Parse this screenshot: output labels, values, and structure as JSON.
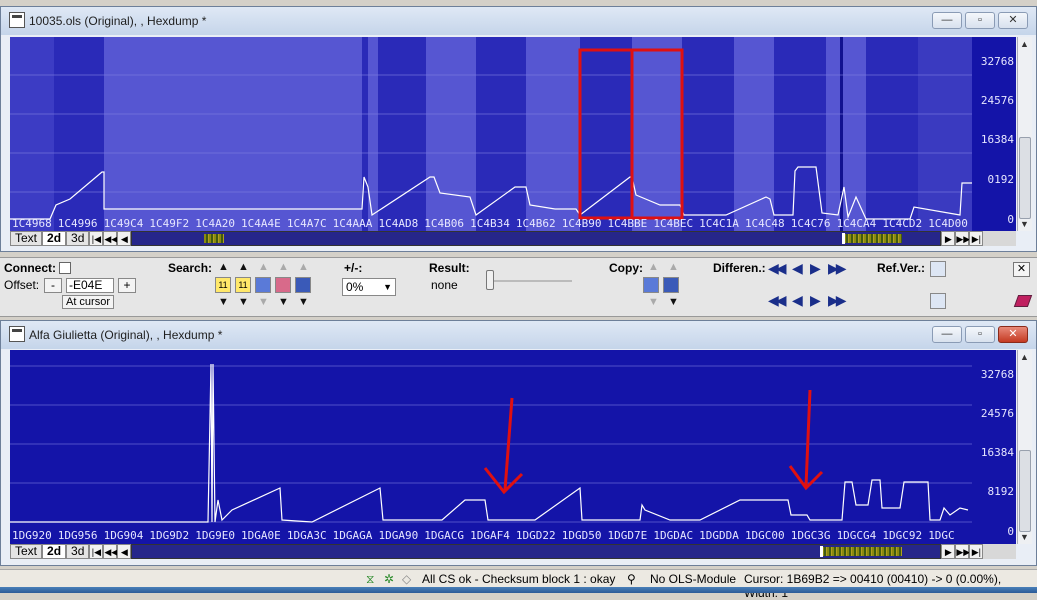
{
  "top_window": {
    "title": "10035.ols (Original), , Hexdump *",
    "y_labels": [
      "32768",
      "24576",
      "16384",
      "0192",
      "0"
    ],
    "x_labels": [
      "1C4968",
      "1C4996",
      "1C49C4",
      "1C49F2",
      "1C4A20",
      "1C4A4E",
      "1C4A7C",
      "1C4AAA",
      "1C4AD8",
      "1C4B06",
      "1C4B34",
      "1C4B62",
      "1C4B90",
      "1C4BBE",
      "1C4BEC",
      "1C4C1A",
      "1C4C48",
      "1C4C76",
      "1C4CA4",
      "1C4CD2",
      "1C4D00"
    ],
    "tabs": [
      "Text",
      "2d",
      "3d"
    ],
    "active_tab": "2d"
  },
  "toolbar": {
    "connect_label": "Connect:",
    "offset_label": "Offset:",
    "offset_value": "-E04E",
    "minus_label": "-",
    "plus_label": "+",
    "at_cursor_label": "At cursor",
    "search_label": "Search:",
    "plusminus_label": "+/-:",
    "percent_value": "0%",
    "result_label": "Result:",
    "result_value": "none",
    "copy_label": "Copy:",
    "differences_label": "Differen.:",
    "refver_label": "Ref.Ver.:",
    "search_icon_a": "11",
    "search_icon_b": "11"
  },
  "bottom_window": {
    "title": "Alfa Giulietta (Original), , Hexdump *",
    "y_labels": [
      "32768",
      "24576",
      "16384",
      "8192",
      "0"
    ],
    "x_labels": [
      "1DG920",
      "1DG956",
      "1DG904",
      "1DG9D2",
      "1DG9E0",
      "1DGA0E",
      "1DGA3C",
      "1DGAGA",
      "1DGA90",
      "1DGACG",
      "1DGAF4",
      "1DGD22",
      "1DGD50",
      "1DGD7E",
      "1DGDAC",
      "1DGDDA",
      "1DGC00",
      "1DGC3G",
      "1DGCG4",
      "1DGC92",
      "1DGC"
    ],
    "tabs": [
      "Text",
      "2d",
      "3d"
    ],
    "active_tab": "2d"
  },
  "statusbar": {
    "checksum_text": "All CS ok - Checksum block 1 : okay",
    "module_text": "No OLS-Module",
    "cursor_text": "Cursor: 1B69B2 => 00410 (00410) -> 0 (0.00%), Width: 1"
  },
  "colors": {
    "plot_bg": "#1414a8",
    "highlight": "#5050d0",
    "annotation_red": "#e01010"
  }
}
